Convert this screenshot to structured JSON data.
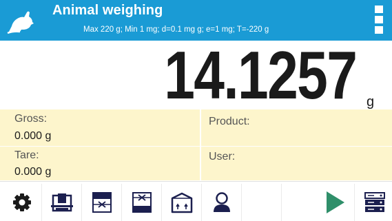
{
  "header": {
    "title": "Animal weighing",
    "subtitle": "Max 220 g; Min 1 mg; d=0.1 mg g; e=1 mg; T=-220 g",
    "mode_icon": "mouse-icon",
    "menu_icon": "vertical-dots-menu-icon"
  },
  "readout": {
    "value": "14.1257",
    "unit": "g"
  },
  "info": {
    "gross_label": "Gross:",
    "gross_value": "0.000 g",
    "tare_label": "Tare:",
    "tare_value": "0.000 g",
    "product_label": "Product:",
    "product_value": "",
    "user_label": "User:",
    "user_value": ""
  },
  "toolbar": {
    "buttons": [
      {
        "icon": "settings-gear-icon"
      },
      {
        "icon": "balance-scale-icon"
      },
      {
        "icon": "cancel-low-limit-icon"
      },
      {
        "icon": "cancel-high-limit-icon"
      },
      {
        "icon": "package-tare-icon"
      },
      {
        "icon": "user-icon"
      },
      {
        "icon": ""
      },
      {
        "icon": ""
      },
      {
        "icon": "start-play-icon"
      },
      {
        "icon": "database-icon"
      }
    ]
  },
  "colors": {
    "header_bg": "#1a9bd5",
    "info_bg": "#fdf5cc",
    "icon_dark": "#1b1f4f",
    "play_green": "#2f8f6a"
  }
}
